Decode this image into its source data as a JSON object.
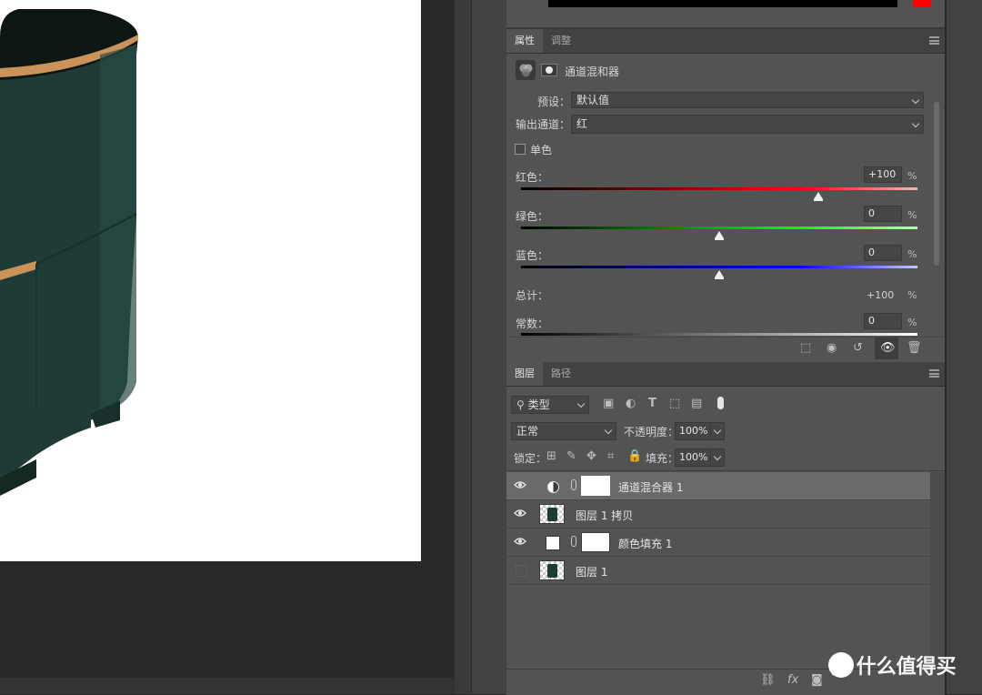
{
  "properties_panel": {
    "tabs": [
      "属性",
      "调整"
    ],
    "active_tab": "属性",
    "title": "通道混和器",
    "preset_label": "预设：",
    "preset_value": "默认值",
    "output_channel_label": "输出通道：",
    "output_channel_value": "红",
    "monochrome_label": "单色",
    "monochrome_checked": false,
    "red_label": "红色：",
    "red_value": "+100",
    "red_fraction": 0.75,
    "green_label": "绿色：",
    "green_value": "0",
    "green_fraction": 0.5,
    "blue_label": "蓝色：",
    "blue_value": "0",
    "blue_fraction": 0.5,
    "total_label": "总计：",
    "total_value": "+100",
    "constant_label": "常数：",
    "constant_value": "0",
    "percent": "%"
  },
  "layers_panel": {
    "tabs": [
      "图层",
      "路径"
    ],
    "active_tab": "图层",
    "filter_label": "类型",
    "blend_mode": "正常",
    "opacity_label": "不透明度：",
    "opacity_value": "100%",
    "lock_label": "锁定：",
    "fill_label": "填充：",
    "fill_value": "100%",
    "layers": [
      {
        "name": "通道混合器 1",
        "visible": true,
        "selected": true,
        "kind": "adjustment"
      },
      {
        "name": "图层 1 拷贝",
        "visible": true,
        "selected": false,
        "kind": "pixel"
      },
      {
        "name": "颜色填充 1",
        "visible": true,
        "selected": false,
        "kind": "fill"
      },
      {
        "name": "图层 1",
        "visible": false,
        "selected": false,
        "kind": "pixel"
      }
    ]
  },
  "watermark": "值 什么值得买",
  "colors": {
    "panel_bg": "#535353",
    "selected_row": "#6a6a6a",
    "product_green": "#1f3b36",
    "gold_trim": "#c9935a"
  }
}
